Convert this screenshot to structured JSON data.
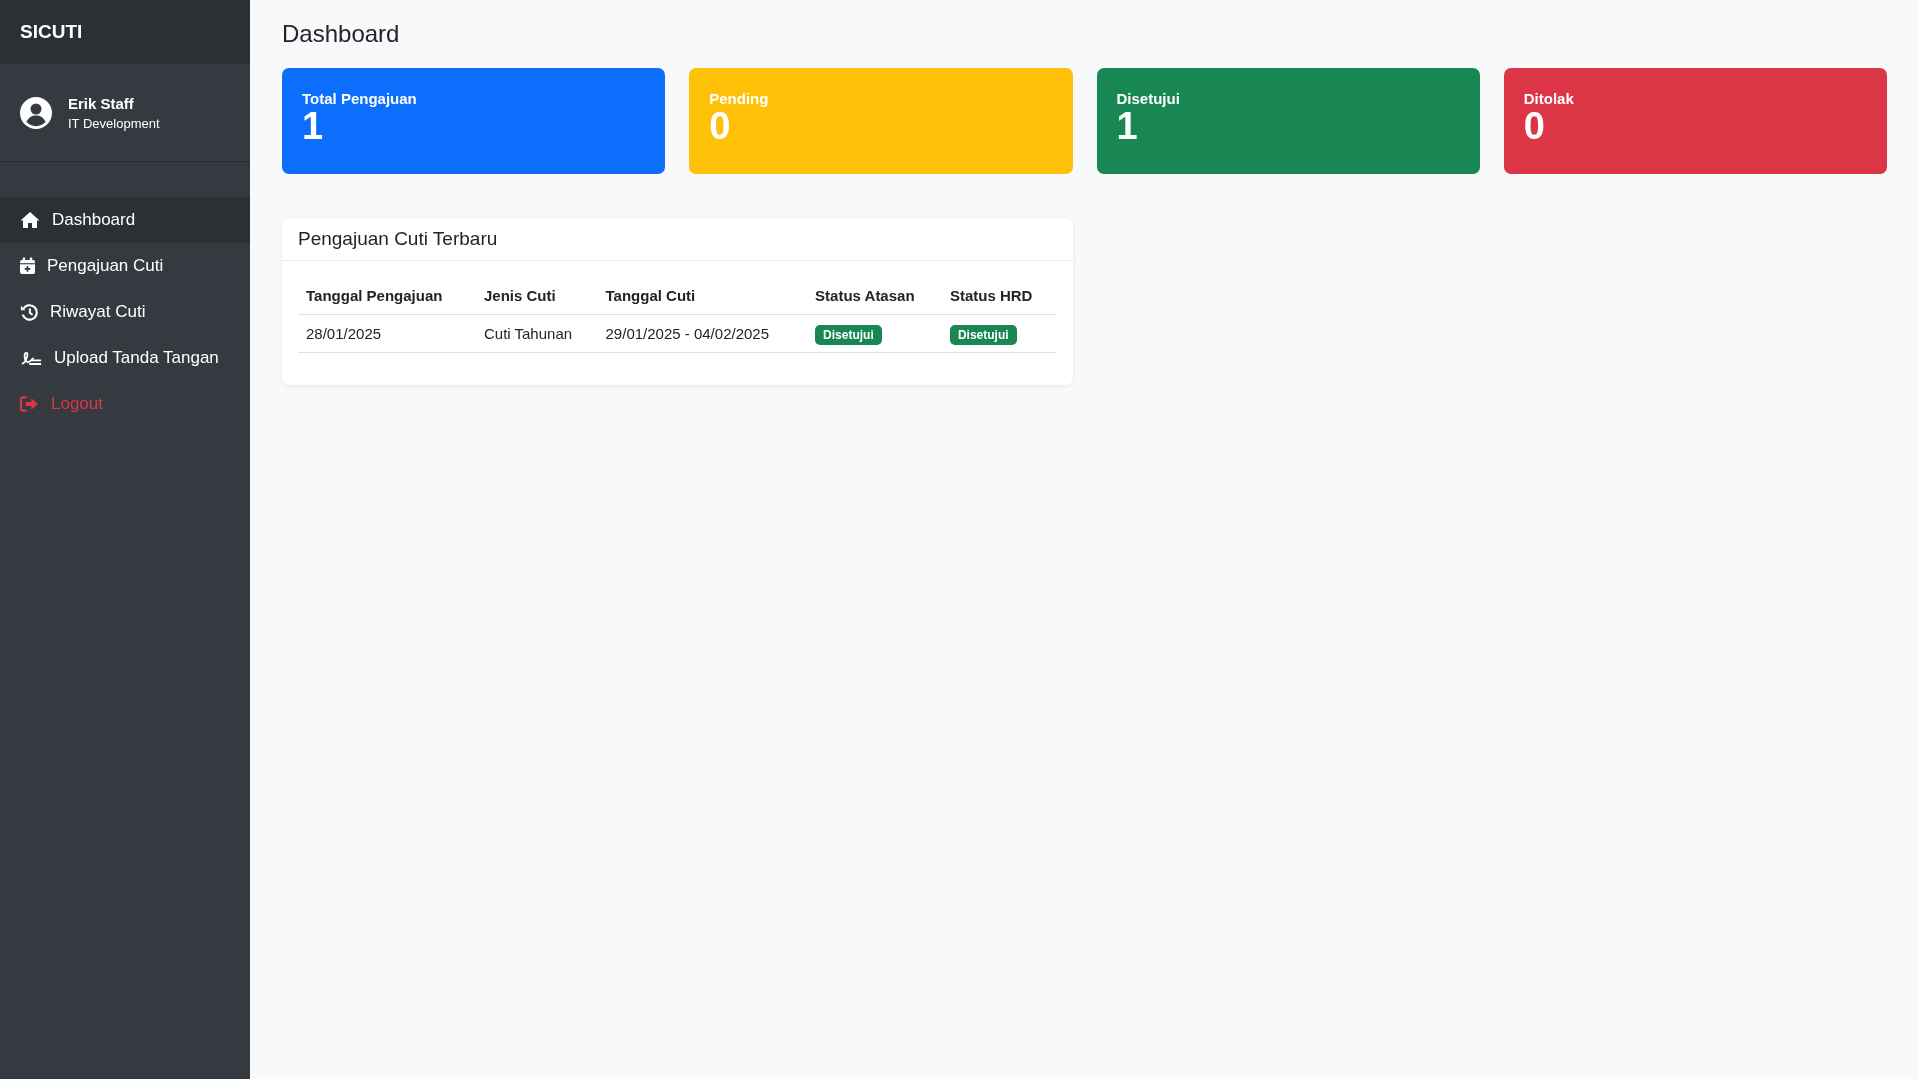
{
  "sidebar": {
    "brand": "SICUTI",
    "user": {
      "name": "Erik Staff",
      "department": "IT Development"
    },
    "items": [
      {
        "label": "Dashboard",
        "kind": "home",
        "selected": true
      },
      {
        "label": "Pengajuan Cuti",
        "kind": "calendar",
        "selected": false
      },
      {
        "label": "Riwayat Cuti",
        "kind": "history",
        "selected": false
      },
      {
        "label": "Upload Tanda Tangan",
        "kind": "signature",
        "selected": false
      },
      {
        "label": "Logout",
        "kind": "logout",
        "selected": false
      }
    ]
  },
  "page_title": "Dashboard",
  "stats": [
    {
      "label": "Total Pengajuan",
      "value": "1",
      "color": "#0d6efd"
    },
    {
      "label": "Pending",
      "value": "0",
      "color": "#ffc107"
    },
    {
      "label": "Disetujui",
      "value": "1",
      "color": "#198754"
    },
    {
      "label": "Ditolak",
      "value": "0",
      "color": "#dc3545"
    }
  ],
  "recent": {
    "title": "Pengajuan Cuti Terbaru",
    "columns": [
      "Tanggal Pengajuan",
      "Jenis Cuti",
      "Tanggal Cuti",
      "Status Atasan",
      "Status HRD"
    ],
    "rows": [
      {
        "submitted": "28/01/2025",
        "type": "Cuti Tahunan",
        "dates": "29/01/2025 - 04/02/2025",
        "status_atasan": {
          "text": "Disetujui",
          "color": "#198754"
        },
        "status_hrd": {
          "text": "Disetujui",
          "color": "#198754"
        }
      }
    ]
  }
}
